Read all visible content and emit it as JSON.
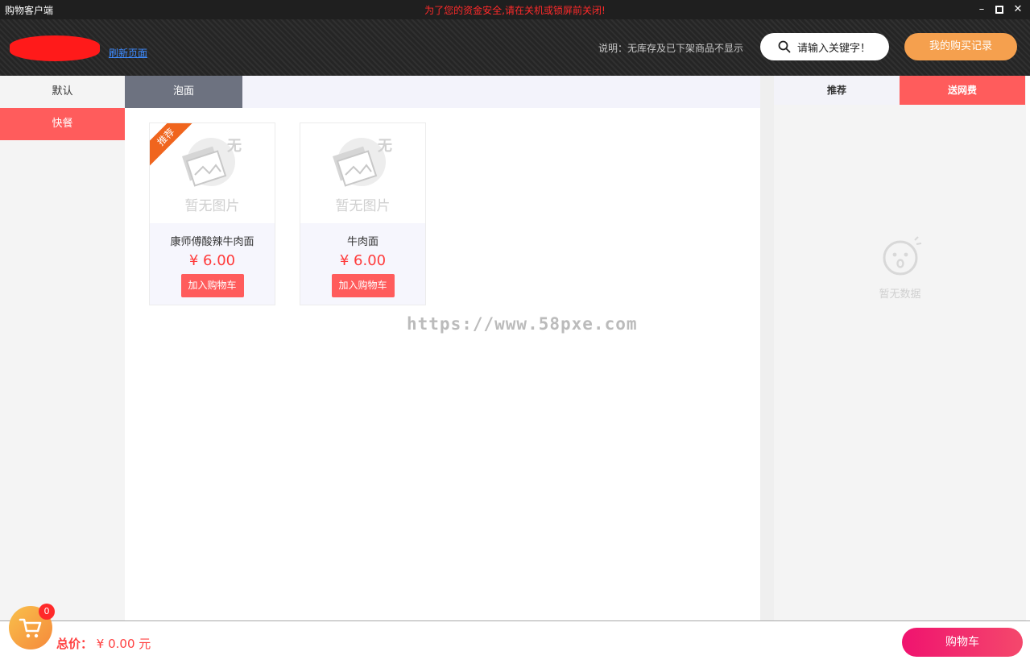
{
  "window": {
    "title": "购物客户端",
    "warning": "为了您的资金安全,请在关机或锁屏前关闭!",
    "controls": {
      "min": "–",
      "close": "✕"
    }
  },
  "header": {
    "refresh_label": "刷新页面",
    "note": "说明：无库存及已下架商品不显示",
    "search_label": "请输入关键字！",
    "record_label": "我的购买记录"
  },
  "sidebar": {
    "items": [
      {
        "label": "默认"
      },
      {
        "label": "快餐"
      }
    ]
  },
  "main": {
    "tabs": [
      {
        "label": "泡面"
      }
    ],
    "products": [
      {
        "no_image": "暂无图片",
        "ribbon": "推荐",
        "name": "康师傅酸辣牛肉面",
        "price": "¥ 6.00",
        "button": "加入购物车"
      },
      {
        "no_image": "暂无图片",
        "name": "牛肉面",
        "price": "¥ 6.00",
        "button": "加入购物车"
      }
    ],
    "placeholder_glyph": "无",
    "watermark": "https://www.58pxe.com"
  },
  "right": {
    "tabs": [
      {
        "label": "推荐"
      },
      {
        "label": "送网费"
      }
    ],
    "empty_text": "暂无数据"
  },
  "bottom": {
    "cart_count": "0",
    "total_label": "总价：",
    "total_value": "¥ 0.00 元",
    "cart_button": "购物车"
  },
  "colors": {
    "accent": "#ff5c5c",
    "price": "#ff3b3b",
    "record_button": "#f5a04e",
    "cart_button": "#f0136f",
    "ribbon": "#f0651e"
  }
}
